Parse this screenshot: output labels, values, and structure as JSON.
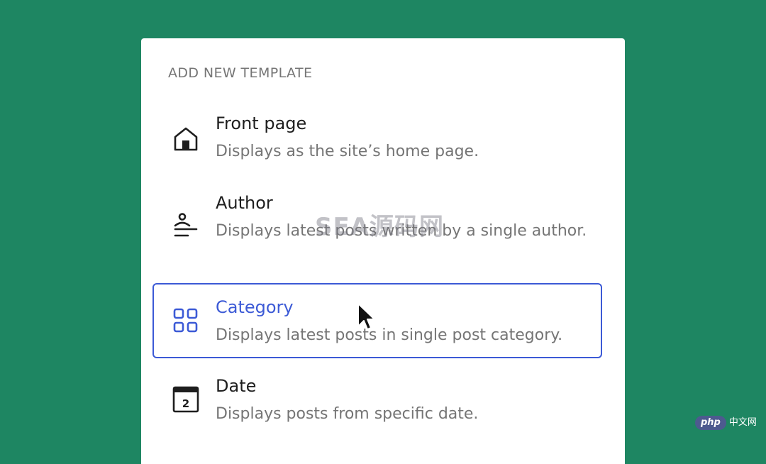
{
  "dialog": {
    "heading": "ADD NEW TEMPLATE",
    "items": [
      {
        "title": "Front page",
        "description": "Displays as the site’s home page.",
        "icon": "home-icon",
        "selected": false
      },
      {
        "title": "Author",
        "description": "Displays latest posts written by a single author.",
        "icon": "author-icon",
        "selected": false
      },
      {
        "title": "Category",
        "description": "Displays latest posts in single post category.",
        "icon": "category-icon",
        "selected": true
      },
      {
        "title": "Date",
        "description": "Displays posts from specific date.",
        "icon": "calendar-icon",
        "calendar_day": "2",
        "selected": false
      }
    ]
  },
  "watermarks": {
    "center": "SEA源码网",
    "corner_badge": "php",
    "corner_text": "中文网"
  },
  "colors": {
    "background": "#1e8662",
    "accent": "#3c5ad6",
    "text": "#1e1e1e",
    "muted": "#757575"
  }
}
